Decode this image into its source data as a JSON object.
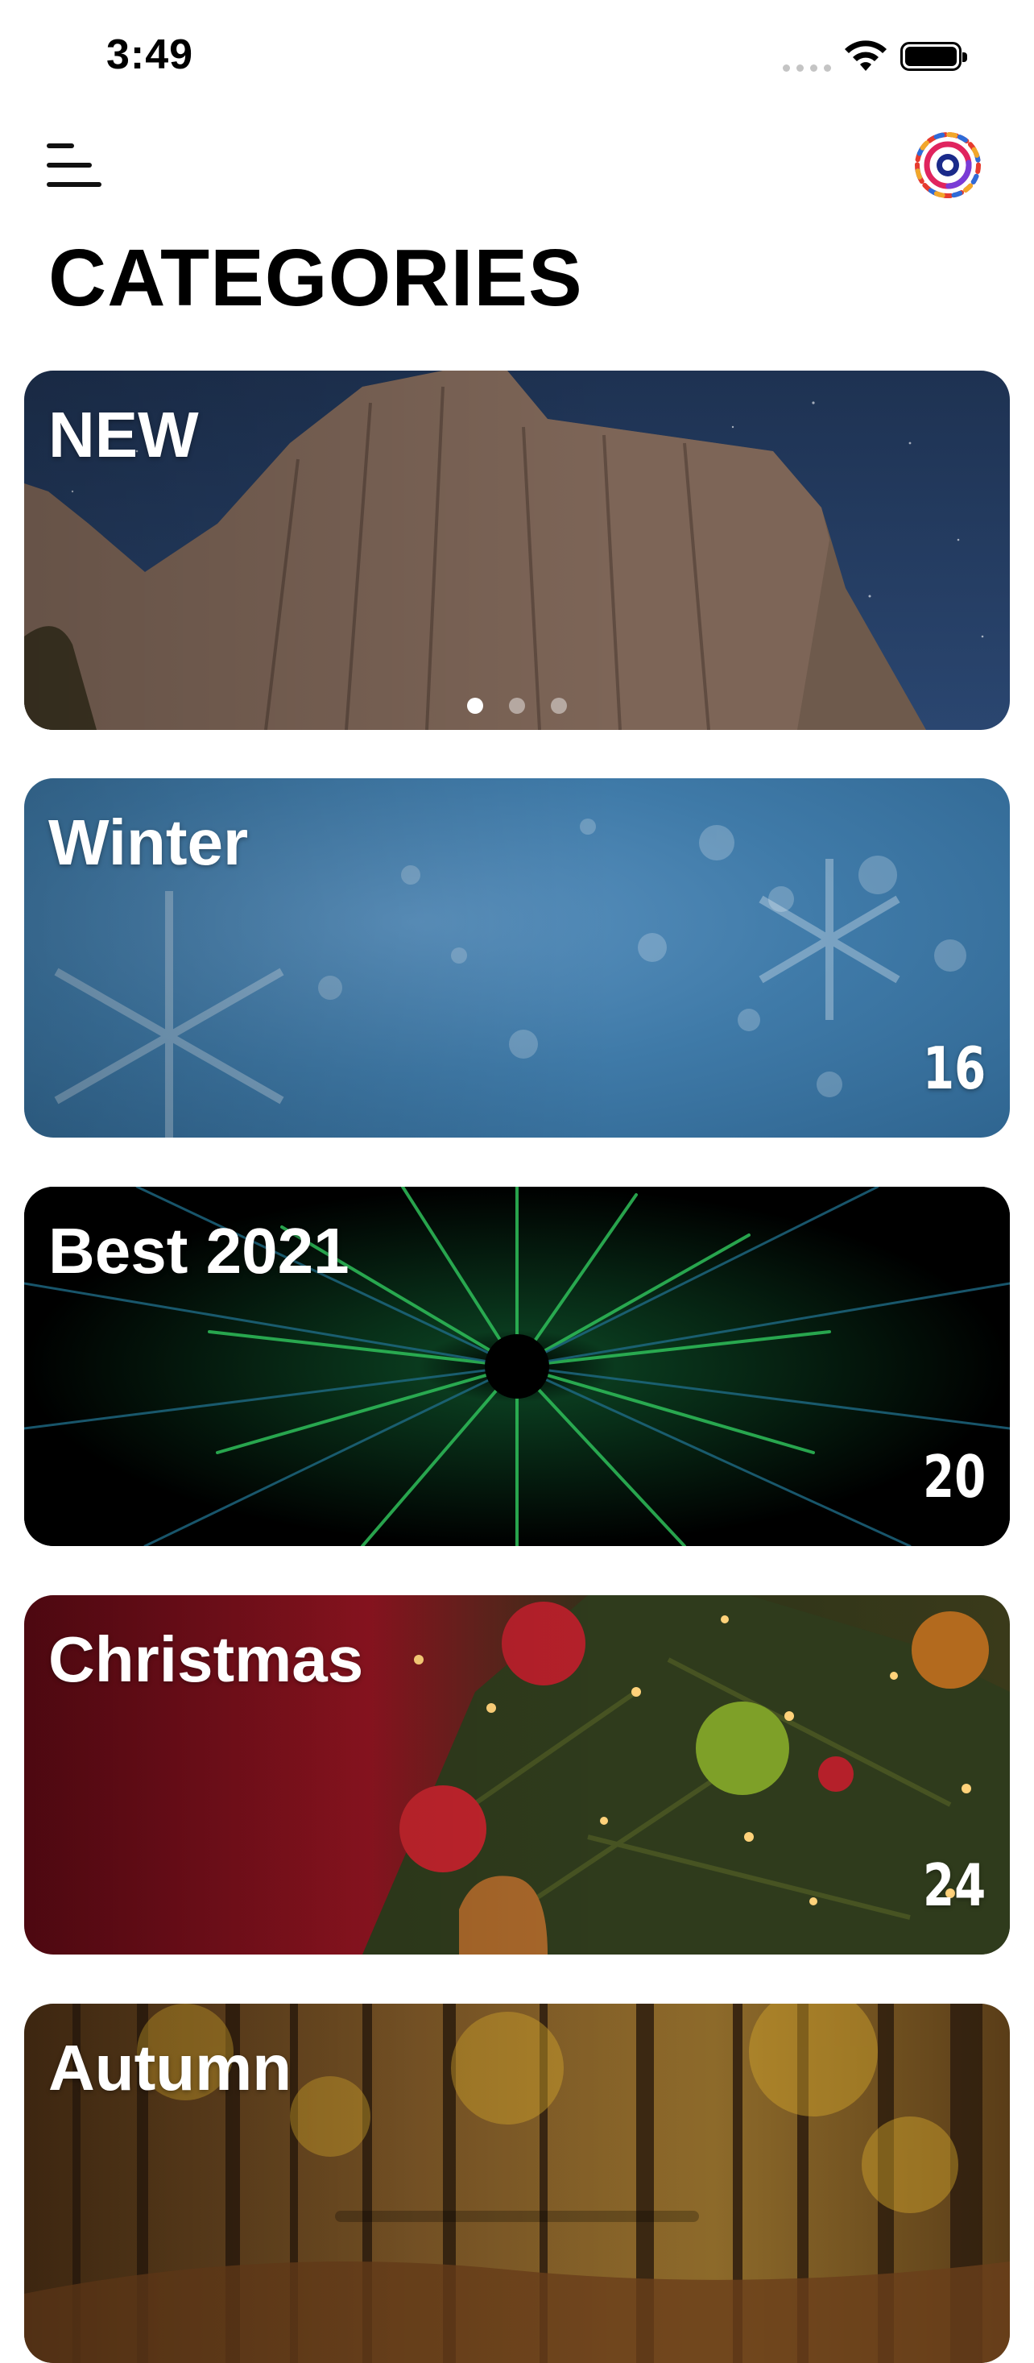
{
  "status_bar": {
    "time": "3:49"
  },
  "header": {
    "title": "CATEGORIES"
  },
  "categories": [
    {
      "label": "NEW",
      "count": ""
    },
    {
      "label": "Winter",
      "count": "16"
    },
    {
      "label": "Best 2021",
      "count": "20"
    },
    {
      "label": "Christmas",
      "count": "24"
    },
    {
      "label": "Autumn",
      "count": ""
    }
  ],
  "carousel": {
    "pages": 3,
    "active_page": 1
  },
  "icons": {
    "menu": "hamburger-menu-icon",
    "logo": "colorful-ring-logo-icon",
    "wifi": "wifi-icon",
    "battery": "battery-icon"
  }
}
